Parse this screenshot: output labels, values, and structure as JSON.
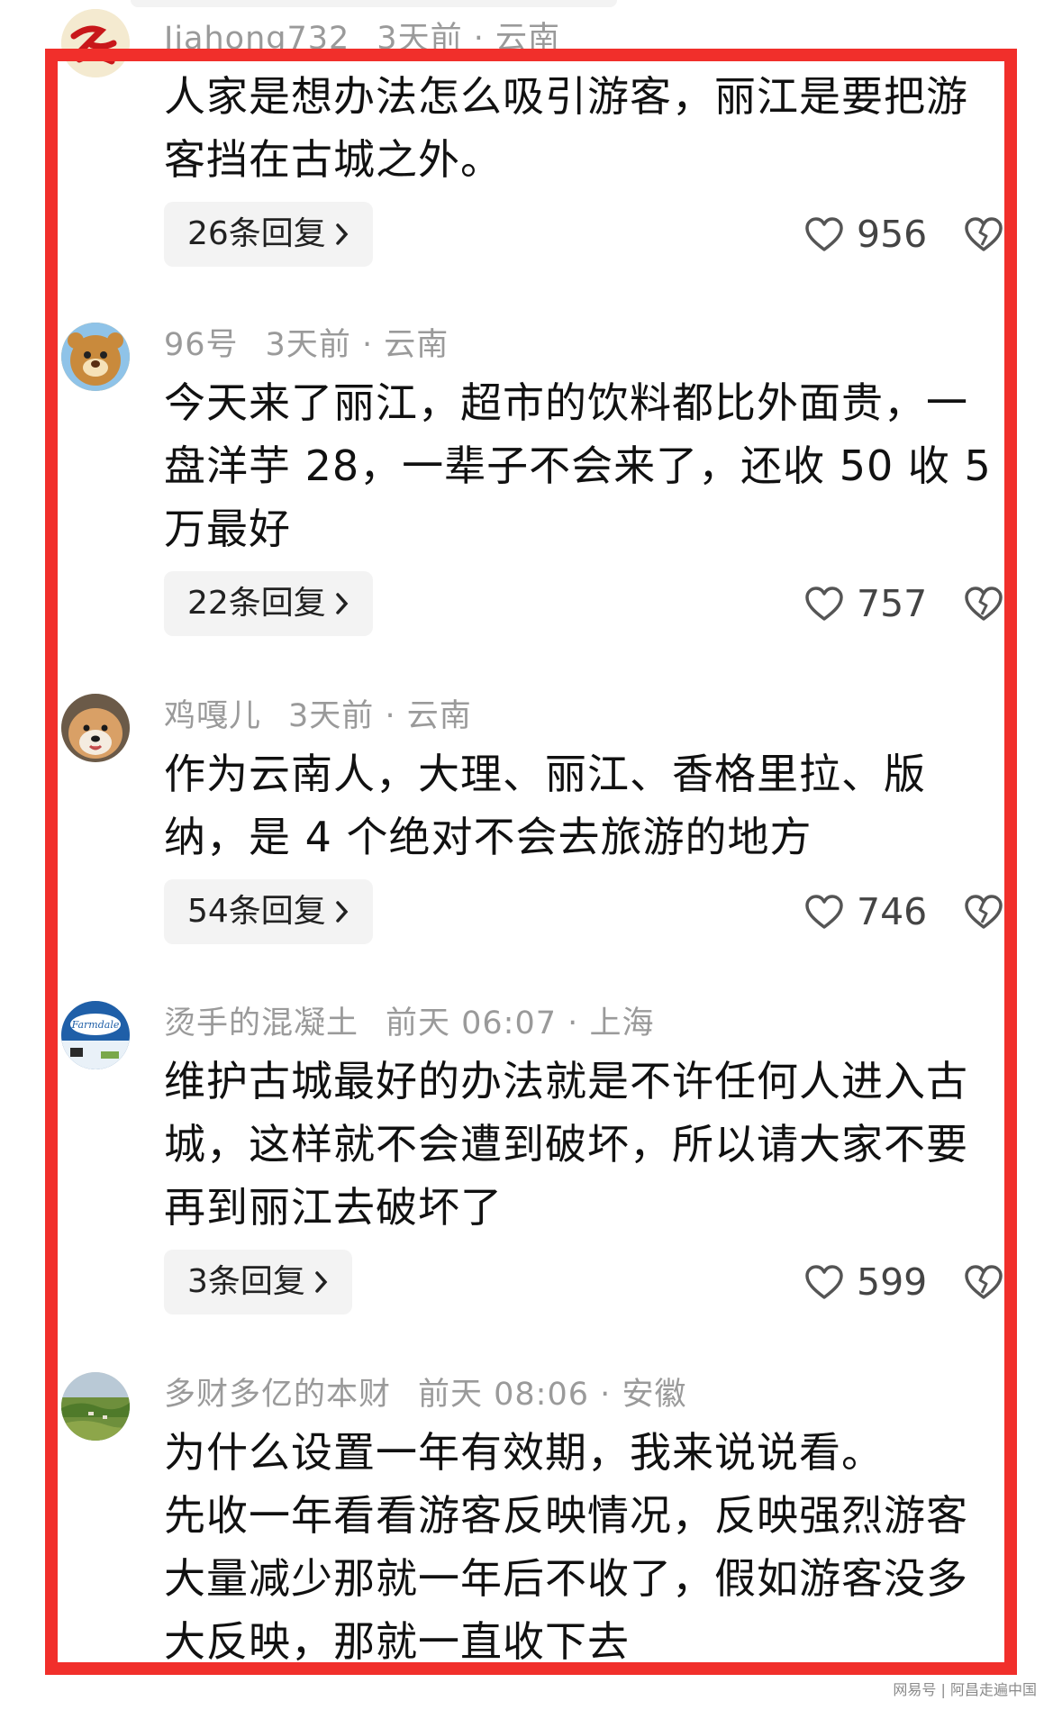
{
  "comments": [
    {
      "username": "Jiahong732",
      "time": "3天前",
      "location": "云南",
      "text": "人家是想办法怎么吸引游客，丽江是要把游\n客挡在古城之外。",
      "replies": "26条回复",
      "likes": "956",
      "avatar_icon": "red-calligraphy-avatar-icon"
    },
    {
      "username": "96号",
      "time": "3天前",
      "location": "云南",
      "text": "今天来了丽江，超市的饮料都比外面贵，一\n盘洋芋 28，一辈子不会来了，还收 50 收 5\n万最好",
      "replies": "22条回复",
      "likes": "757",
      "avatar_icon": "cartoon-bear-avatar-icon"
    },
    {
      "username": "鸡嘎儿",
      "time": "3天前",
      "location": "云南",
      "text": "作为云南人，大理、丽江、香格里拉、版\n纳，是 4 个绝对不会去旅游的地方",
      "replies": "54条回复",
      "likes": "746",
      "avatar_icon": "dog-avatar-icon"
    },
    {
      "username": "烫手的混凝土",
      "time": "前天 06:07",
      "location": "上海",
      "text": "维护古城最好的办法就是不许任何人进入古\n城，这样就不会遭到破坏，所以请大家不要\n再到丽江去破坏了",
      "replies": "3条回复",
      "likes": "599",
      "avatar_icon": "milk-carton-avatar-icon",
      "avatar_logo_text": "Farmdale"
    },
    {
      "username": "多财多亿的本财",
      "time": "前天 08:06",
      "location": "安徽",
      "text": "为什么设置一年有效期，我来说说看。\n先收一年看看游客反映情况，反映强烈游客\n大量减少那就一年后不收了，假如游客没多\n大反映，那就一直收下去",
      "avatar_icon": "landscape-avatar-icon"
    }
  ],
  "meta_separator": "·",
  "icons": {
    "like": "heart-outline-icon",
    "dislike": "broken-heart-icon",
    "reply_arrow": "chevron-right-icon"
  },
  "colors": {
    "highlight_frame": "#f12f2b",
    "meta_gray": "#9a9a9a",
    "reply_bg": "#f3f3f3"
  },
  "watermark": "网易号 | 阿昌走遍中国"
}
